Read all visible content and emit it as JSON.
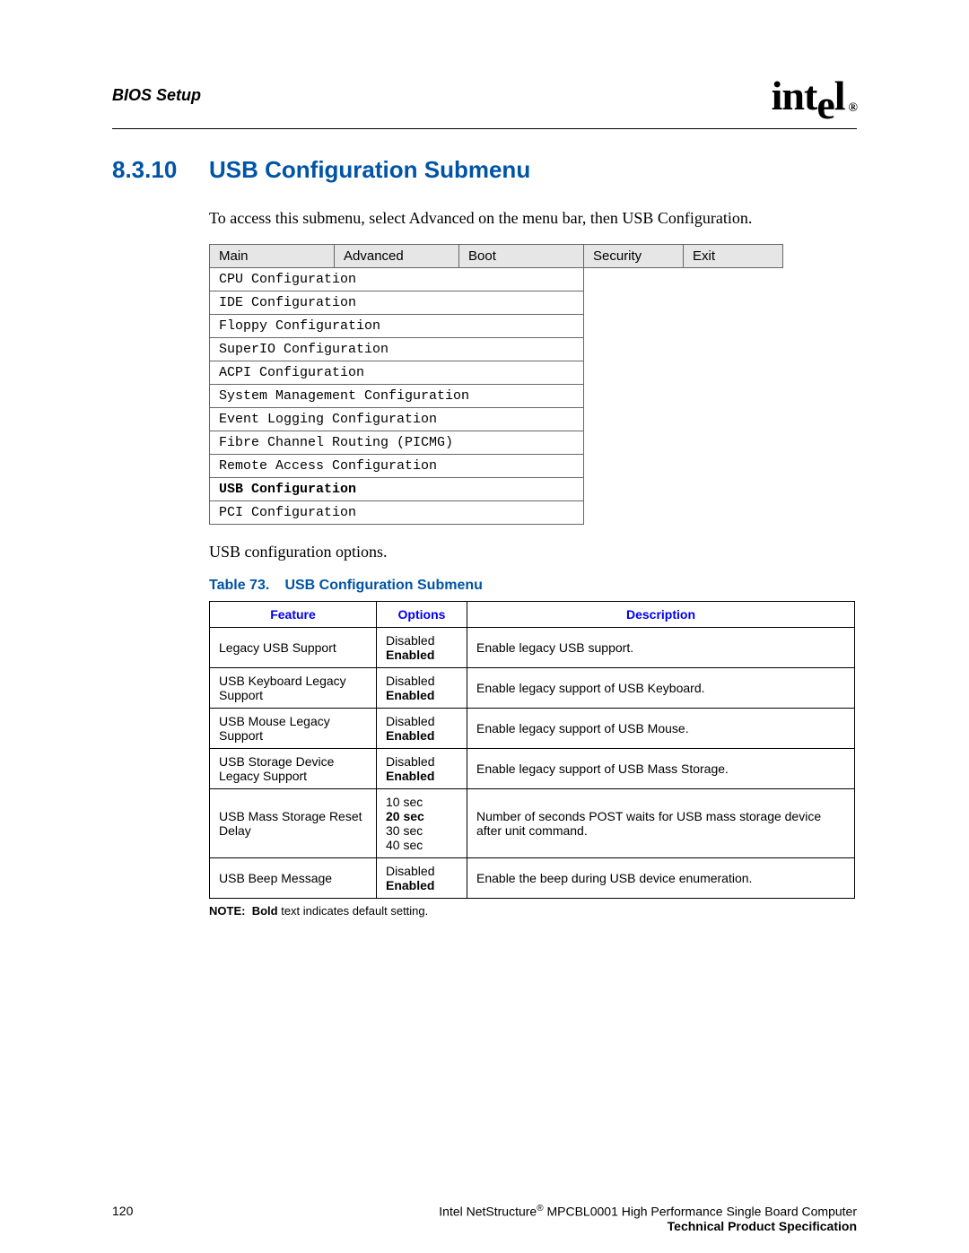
{
  "header": {
    "title": "BIOS Setup",
    "logo_text": "intel",
    "logo_reg": "®"
  },
  "section": {
    "number": "8.3.10",
    "title": "USB Configuration Submenu",
    "intro": "To access this submenu, select Advanced on the menu bar, then USB Configuration."
  },
  "menu": {
    "tabs": [
      "Main",
      "Advanced",
      "Boot",
      "Security",
      "Exit"
    ],
    "items": [
      {
        "label": "CPU Configuration",
        "bold": false
      },
      {
        "label": "IDE Configuration",
        "bold": false
      },
      {
        "label": "Floppy Configuration",
        "bold": false
      },
      {
        "label": "SuperIO Configuration",
        "bold": false
      },
      {
        "label": "ACPI Configuration",
        "bold": false
      },
      {
        "label": "System Management Configuration",
        "bold": false
      },
      {
        "label": "Event Logging Configuration",
        "bold": false
      },
      {
        "label": "Fibre Channel Routing (PICMG)",
        "bold": false
      },
      {
        "label": "Remote Access Configuration",
        "bold": false
      },
      {
        "label": "USB Configuration",
        "bold": true
      },
      {
        "label": "PCI Configuration",
        "bold": false
      }
    ],
    "subtext": "USB configuration options."
  },
  "table": {
    "caption_label": "Table 73.",
    "caption_title": "USB Configuration Submenu",
    "headers": {
      "feature": "Feature",
      "options": "Options",
      "description": "Description"
    },
    "rows": [
      {
        "feature": "Legacy USB Support",
        "options": [
          {
            "t": "Disabled",
            "b": false
          },
          {
            "t": "Enabled",
            "b": true
          }
        ],
        "description": "Enable legacy USB support."
      },
      {
        "feature": "USB Keyboard Legacy Support",
        "options": [
          {
            "t": "Disabled",
            "b": false
          },
          {
            "t": "Enabled",
            "b": true
          }
        ],
        "description": "Enable legacy support of USB Keyboard."
      },
      {
        "feature": "USB Mouse Legacy Support",
        "options": [
          {
            "t": "Disabled",
            "b": false
          },
          {
            "t": "Enabled",
            "b": true
          }
        ],
        "description": "Enable legacy support of USB Mouse."
      },
      {
        "feature": "USB Storage Device Legacy Support",
        "options": [
          {
            "t": "Disabled",
            "b": false
          },
          {
            "t": "Enabled",
            "b": true
          }
        ],
        "description": "Enable legacy support of USB Mass Storage."
      },
      {
        "feature": "USB Mass Storage Reset Delay",
        "options": [
          {
            "t": "10 sec",
            "b": false
          },
          {
            "t": "20 sec",
            "b": true
          },
          {
            "t": "30 sec",
            "b": false
          },
          {
            "t": "40 sec",
            "b": false
          }
        ],
        "description": "Number of seconds POST waits for USB mass storage device after unit command."
      },
      {
        "feature": "USB Beep Message",
        "options": [
          {
            "t": "Disabled",
            "b": false
          },
          {
            "t": "Enabled",
            "b": true
          }
        ],
        "description": "Enable the beep during USB device enumeration."
      }
    ],
    "note_label": "NOTE:",
    "note_bold": "Bold",
    "note_rest": " text indicates default setting."
  },
  "footer": {
    "page": "120",
    "line1a": "Intel NetStructure",
    "line1b": " MPCBL0001 High Performance Single Board Computer",
    "line2": "Technical Product Specification",
    "reg": "®"
  }
}
